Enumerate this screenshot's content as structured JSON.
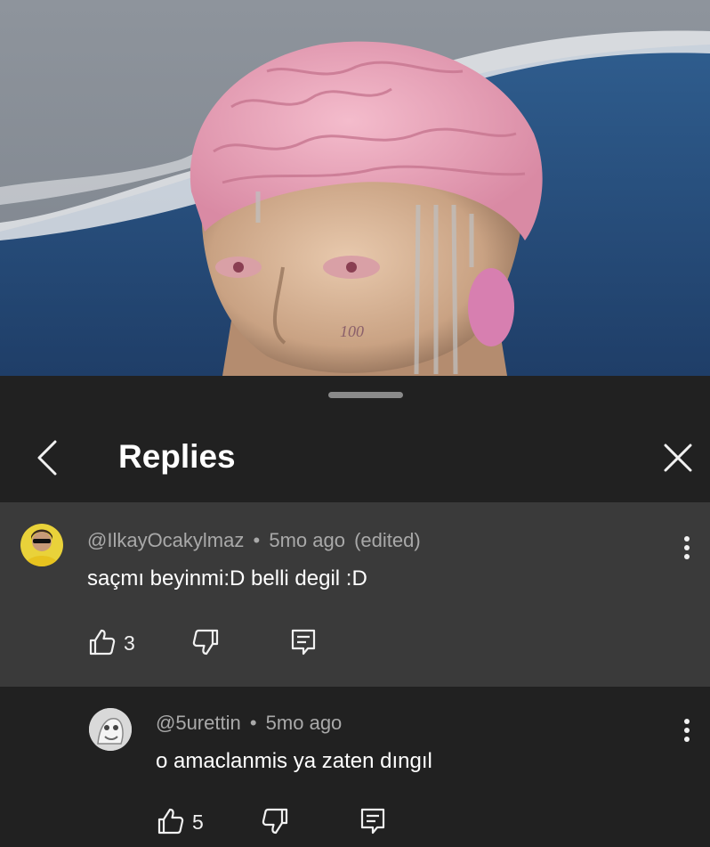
{
  "sheet": {
    "title": "Replies"
  },
  "comments": [
    {
      "handle": "@IlkayOcakylmaz",
      "separator": "•",
      "time": "5mo ago",
      "edited": "(edited)",
      "text": "saçmı beyinmi:D belli degil :D",
      "likes": "3"
    },
    {
      "handle": "@5urettin",
      "separator": "•",
      "time": "5mo ago",
      "text": "o amaclanmis ya zaten dıngıl",
      "likes": "5"
    }
  ],
  "video": {
    "face_tattoo": "100"
  },
  "colors": {
    "sheet_background": "#212121",
    "highlight_comment": "#3a3a3a",
    "secondary_text": "#a9a9a9",
    "primary_text": "#ffffff"
  }
}
